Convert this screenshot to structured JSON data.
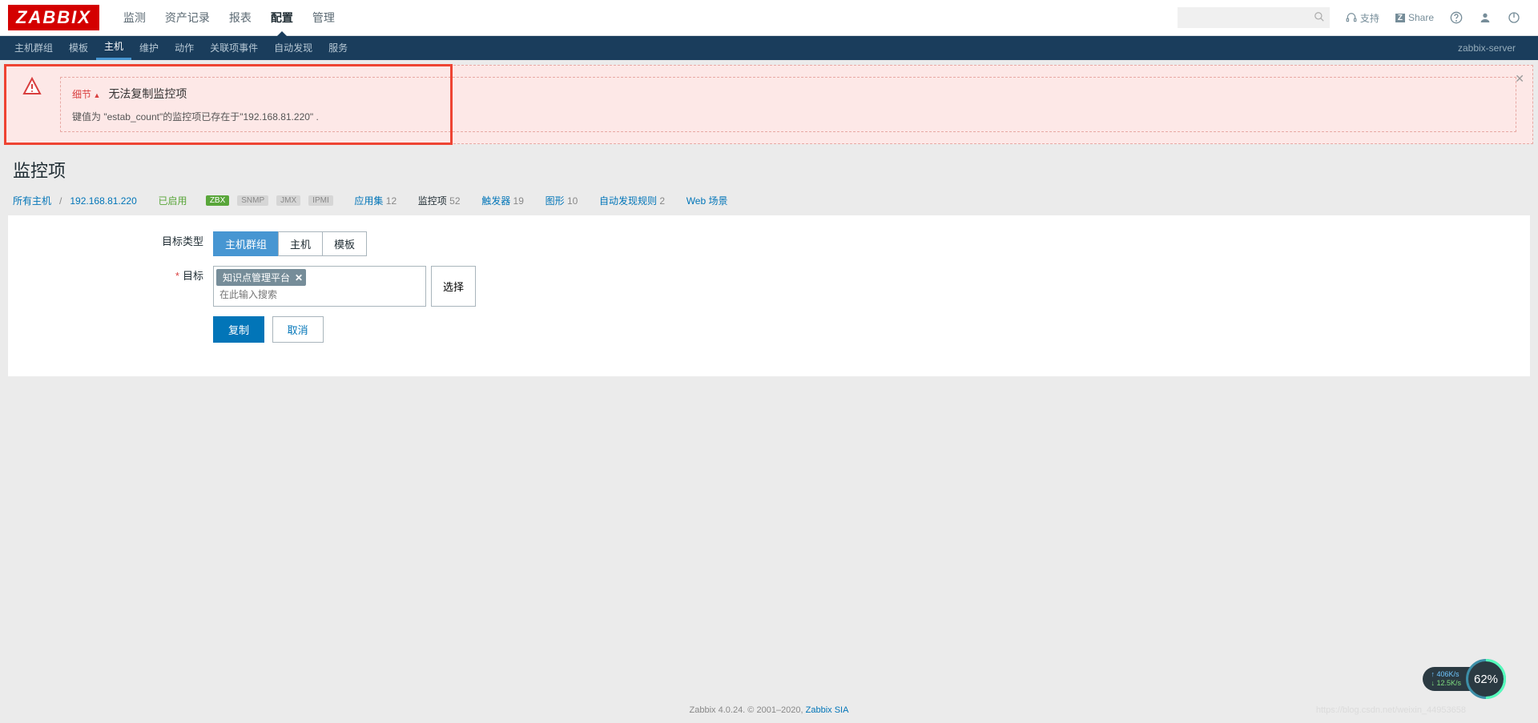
{
  "header": {
    "logo": "ZABBIX",
    "nav": [
      "监测",
      "资产记录",
      "报表",
      "配置",
      "管理"
    ],
    "nav_active": 3,
    "support": "支持",
    "share": "Share",
    "share_badge": "Z"
  },
  "subnav": {
    "items": [
      "主机群组",
      "模板",
      "主机",
      "维护",
      "动作",
      "关联项事件",
      "自动发现",
      "服务"
    ],
    "active": 2,
    "server": "zabbix-server"
  },
  "alert": {
    "details_link": "细节",
    "title": "无法复制监控项",
    "message": "键值为 \"estab_count\"的监控项已存在于\"192.168.81.220\" ."
  },
  "page_title": "监控项",
  "breadcrumb": {
    "all_hosts": "所有主机",
    "host": "192.168.81.220",
    "status": "已启用",
    "badges": {
      "zbx": "ZBX",
      "snmp": "SNMP",
      "jmx": "JMX",
      "ipmi": "IPMI"
    },
    "tabs": [
      {
        "label": "应用集",
        "count": "12"
      },
      {
        "label": "监控项",
        "count": "52"
      },
      {
        "label": "触发器",
        "count": "19"
      },
      {
        "label": "图形",
        "count": "10"
      },
      {
        "label": "自动发现规则",
        "count": "2"
      },
      {
        "label": "Web 场景",
        "count": ""
      }
    ],
    "tabs_active": 1
  },
  "form": {
    "target_type_label": "目标类型",
    "types": [
      "主机群组",
      "主机",
      "模板"
    ],
    "types_active": 0,
    "target_label": "目标",
    "target_tag": "知识点管理平台",
    "target_placeholder": "在此输入搜索",
    "select_btn": "选择",
    "copy_btn": "复制",
    "cancel_btn": "取消"
  },
  "footer": {
    "text": "Zabbix 4.0.24. © 2001–2020, ",
    "link": "Zabbix SIA"
  },
  "watermark": "https://blog.csdn.net/weixin_44953658",
  "speed": {
    "up": "406K/s",
    "down": "12.5K/s",
    "pct": "62%"
  }
}
